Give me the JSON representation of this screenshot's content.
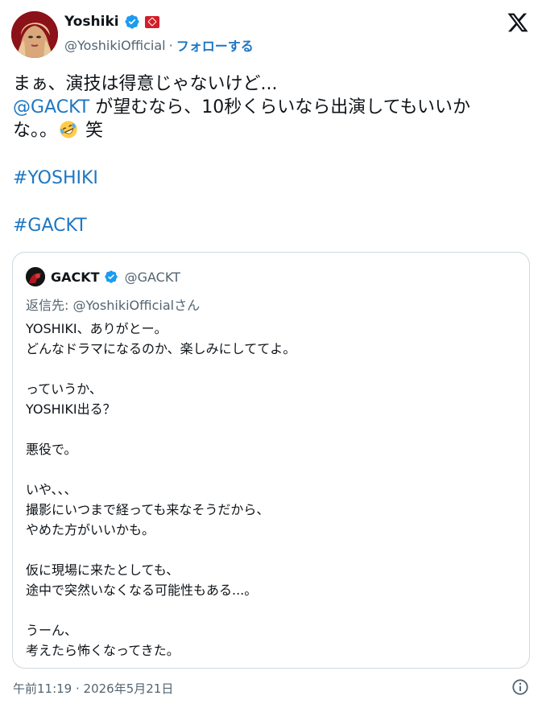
{
  "author": {
    "name": "Yoshiki",
    "handle": "@YoshikiOfficial",
    "separator": "·",
    "follow_label": "フォローする",
    "verified_color": "#1d9bf0"
  },
  "tweet": {
    "line1": "まぁ、演技は得意じゃないけど...",
    "mention": "@GACKT",
    "line2_rest": " が望むなら、10秒くらいなら出演してもいいか",
    "line3_start": "な。。",
    "emoji": "rolling-on-floor-laughing-emoji",
    "line3_end": " 笑",
    "hashtags": [
      "#YOSHIKI",
      "#GACKT"
    ]
  },
  "quote": {
    "name": "GACKT",
    "handle": "@GACKT",
    "reply_to": "返信先: @YoshikiOfficialさん",
    "text": "YOSHIKI、ありがとー。\nどんなドラマになるのか、楽しみにしててよ。\n\nっていうか、\nYOSHIKI出る？\n\n悪役で。\n\nいや、、、\n撮影にいつまで経っても来なそうだから、\nやめた方がいいかも。\n\n仮に現場に来たとしても、\n途中で突然いなくなる可能性もある...。\n\nうーん、\n考えたら怖くなってきた。"
  },
  "footer": {
    "timestamp": "午前11:19 · 2026年5月21日"
  },
  "colors": {
    "link": "#1d76c2",
    "secondary_text": "#536471",
    "border": "#cfd9de",
    "affiliate_badge": "#d21f2a"
  }
}
